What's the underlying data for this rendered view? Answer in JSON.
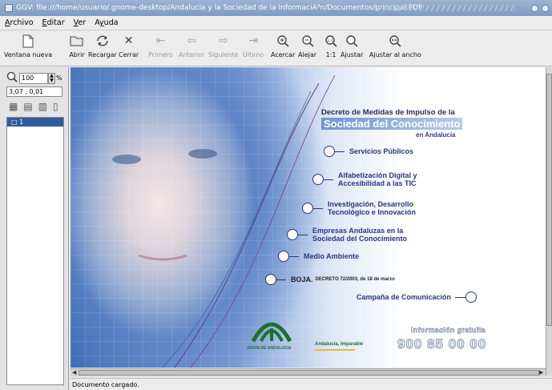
{
  "window": {
    "title": "GGV: file:///home/usuario/.gnome-desktop/Andalucia y la Sociedad de la InformaciA³n/Documentos/principal.PDF"
  },
  "menu": [
    {
      "label": "Archivo",
      "mnemonic": "A"
    },
    {
      "label": "Editar",
      "mnemonic": "E"
    },
    {
      "label": "Ver",
      "mnemonic": "V"
    },
    {
      "label": "Ayuda",
      "mnemonic": "y"
    }
  ],
  "toolbar": {
    "new_window": "Ventana nueva",
    "open": "Abrir",
    "reload": "Recargar",
    "close": "Cerrar",
    "first": "Primero",
    "prev": "Anterior",
    "next": "Siguiente",
    "last": "Último",
    "zoom_in": "Acercar",
    "zoom_out": "Alejar",
    "one_to_one": "1:1",
    "fit": "Ajustar",
    "fit_width": "Ajustar al ancho"
  },
  "sidebar": {
    "zoom_value": "100",
    "zoom_unit": "%",
    "coordinates": "3,07 , 0,01",
    "pages": [
      "1"
    ]
  },
  "document": {
    "heading_line1": "Decreto de Medidas de Impulso de la",
    "heading_line2": "Sociedad del Conocimiento",
    "heading_line3": "en Andalucía",
    "items": [
      {
        "text": "Servicios Públicos"
      },
      {
        "text": "Alfabetización Digital y",
        "text2": "Accesibilidad a las TIC"
      },
      {
        "text": "Investigación, Desarrollo",
        "text2": "Tecnológico e Innovación"
      },
      {
        "text": "Empresas Andaluzas en la",
        "text2": "Sociedad del Conocimiento"
      },
      {
        "text": "Medio Ambiente"
      }
    ],
    "boja": "BOJA.",
    "decreto": "DECRETO 72/2003, de 18 de marzo",
    "campana": "Campaña de Comunicación",
    "junta": "JUNTA DE ANDALUCIA",
    "imparable": "Andalucía, Imparable",
    "info_label": "Información gratuita",
    "phone": "900 85 00 00"
  },
  "status": "Documento cargado."
}
